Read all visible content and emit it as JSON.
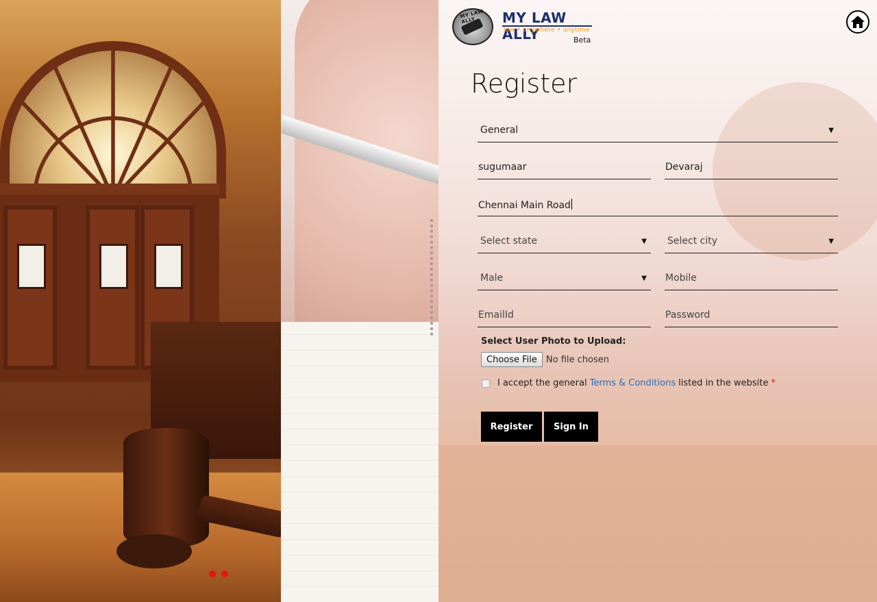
{
  "logo": {
    "seal_text": "MY LAW ALLY",
    "title": "MY LAW ALLY",
    "tagline": "law  •  anywhere  •  anytime",
    "beta": "Beta"
  },
  "header": {
    "home_icon": "home-icon"
  },
  "form": {
    "title": "Register",
    "user_type": "General",
    "first_name": "sugumaar",
    "last_name": "Devaraj",
    "address": "Chennai Main Road",
    "state": "Select state",
    "city": "Select city",
    "gender": "Male",
    "mobile_placeholder": "Mobile",
    "email_placeholder": "EmailId",
    "password_placeholder": "Password",
    "upload_label": "Select User Photo to Upload:",
    "choose_file": "Choose File",
    "no_file": "No file chosen",
    "terms_prefix": "I accept the general",
    "terms_link": "Terms & Conditions",
    "terms_suffix": "listed in the website",
    "required_mark": "*",
    "register_button": "Register",
    "signin_button": "Sign In"
  },
  "slider": {
    "dot_count": 2,
    "dot_color": "#e1180f"
  },
  "colors": {
    "brand_navy": "#1c2f6e",
    "brand_orange": "#f19a16",
    "link_blue": "#2d6eb8",
    "button_black": "#000000"
  }
}
